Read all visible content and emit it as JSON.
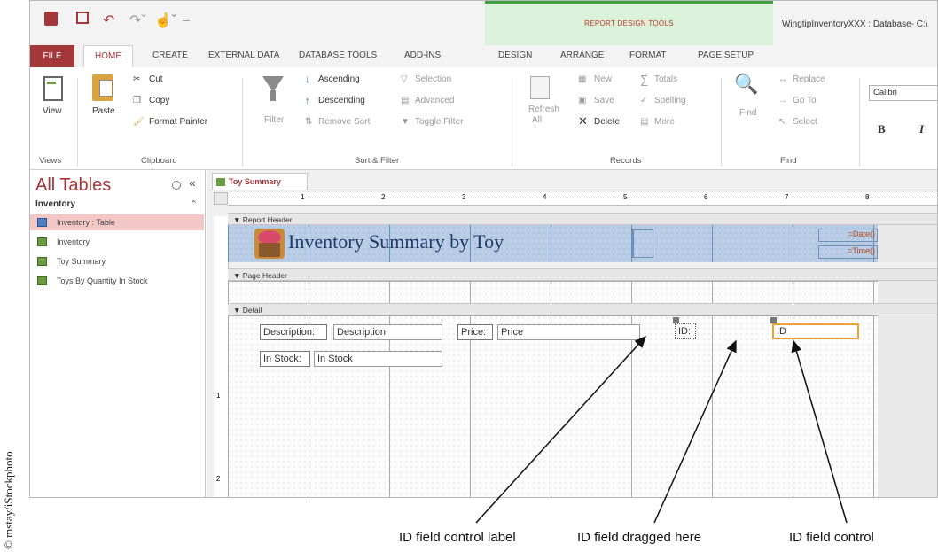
{
  "credit": "© mstay/iStockphoto",
  "quick_access": {
    "icons": [
      "access-logo-icon",
      "save-icon",
      "undo-icon",
      "redo-icon",
      "touch-mode-icon",
      "customize-icon"
    ]
  },
  "context_group": {
    "title": "REPORT DESIGN TOOLS",
    "color": "#c0392b"
  },
  "app_title": "WingtipInventoryXXX : Database- C:\\",
  "tabs": {
    "file": "FILE",
    "home": "HOME",
    "create": "CREATE",
    "external": "EXTERNAL DATA",
    "dbtools": "DATABASE TOOLS",
    "addins": "ADD-INS",
    "design": "DESIGN",
    "arrange": "ARRANGE",
    "format": "FORMAT",
    "pagesetup": "PAGE SETUP"
  },
  "ribbon": {
    "views": {
      "view": "View",
      "group": "Views"
    },
    "clipboard": {
      "paste": "Paste",
      "cut": "Cut",
      "copy": "Copy",
      "format_painter": "Format Painter",
      "group": "Clipboard"
    },
    "sortfilter": {
      "filter": "Filter",
      "ascending": "Ascending",
      "descending": "Descending",
      "remove_sort": "Remove Sort",
      "selection": "Selection",
      "advanced": "Advanced",
      "toggle": "Toggle Filter",
      "group": "Sort & Filter"
    },
    "records": {
      "refresh": "Refresh",
      "refresh_all": "All",
      "new": "New",
      "save": "Save",
      "delete": "Delete",
      "totals": "Totals",
      "spelling": "Spelling",
      "more": "More",
      "group": "Records"
    },
    "find": {
      "find": "Find",
      "replace": "Replace",
      "goto": "Go To",
      "select": "Select",
      "group": "Find"
    },
    "text": {
      "font": "Calibri",
      "bold": "B",
      "italic": "I"
    }
  },
  "nav": {
    "title": "All Tables",
    "group": "Inventory",
    "items": [
      {
        "label": "Inventory : Table",
        "selected": true
      },
      {
        "label": "Inventory",
        "selected": false
      },
      {
        "label": "Toy Summary",
        "selected": false
      },
      {
        "label": "Toys By Quantity In Stock",
        "selected": false
      }
    ]
  },
  "report": {
    "tab": "Toy Summary",
    "ruler_marks": [
      "1",
      "2",
      "3",
      "4",
      "5",
      "6",
      "7",
      "8"
    ],
    "sections": {
      "report_header": "Report Header",
      "page_header": "Page Header",
      "detail": "Detail"
    },
    "title": "Inventory Summary by Toy",
    "date": "=Date()",
    "time": "=Time()",
    "controls": {
      "description_label": "Description:",
      "description": "Description",
      "price_label": "Price:",
      "price": "Price",
      "instock_label": "In Stock:",
      "instock": "In Stock",
      "id_label": "ID:",
      "id": "ID"
    },
    "vruler_marks": [
      "1",
      "2"
    ]
  },
  "annotations": {
    "label": "ID field control label",
    "dragged": "ID field dragged here",
    "control": "ID field control"
  }
}
